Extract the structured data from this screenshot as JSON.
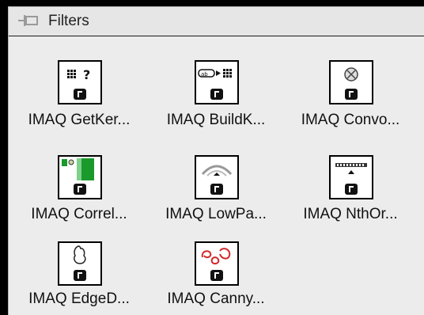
{
  "palette": {
    "title": "Filters",
    "items": [
      {
        "label": "IMAQ GetKer...",
        "icon": "get-kernel-icon"
      },
      {
        "label": "IMAQ BuildK...",
        "icon": "build-kernel-icon"
      },
      {
        "label": "IMAQ Convo...",
        "icon": "convolute-icon"
      },
      {
        "label": "IMAQ Correl...",
        "icon": "correlate-icon"
      },
      {
        "label": "IMAQ LowPa...",
        "icon": "low-pass-icon"
      },
      {
        "label": "IMAQ NthOr...",
        "icon": "nth-order-icon"
      },
      {
        "label": "IMAQ EdgeD...",
        "icon": "edge-detection-icon"
      },
      {
        "label": "IMAQ Canny...",
        "icon": "canny-edge-icon"
      }
    ],
    "colors": {
      "background": "#ececec",
      "frame": "#000000",
      "correlate_green": "#1a9a2a",
      "canny_red": "#d22a2a"
    }
  }
}
